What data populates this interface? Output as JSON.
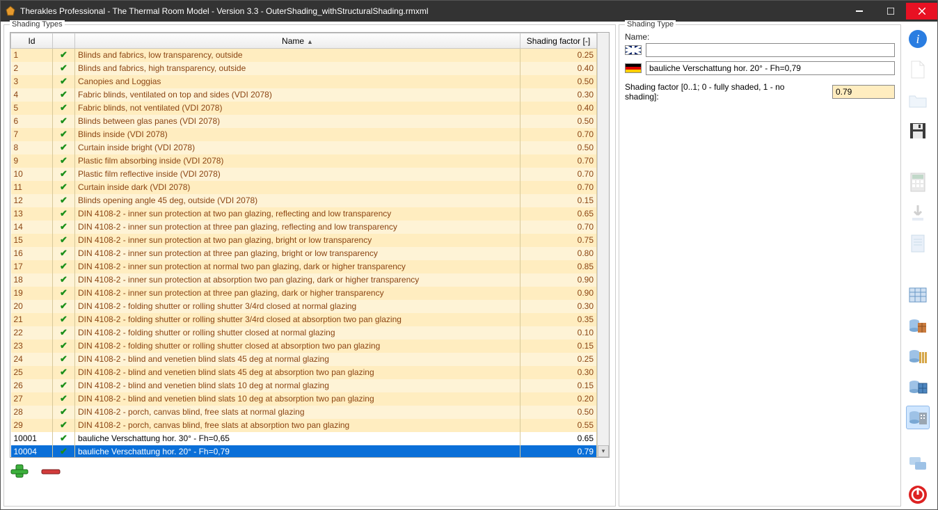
{
  "window": {
    "title": "Therakles Professional - The Thermal Room Model - Version 3.3 - OuterShading_withStructuralShading.rmxml"
  },
  "left": {
    "groupLabel": "Shading Types",
    "columns": {
      "id": "Id",
      "name": "Name",
      "factor": "Shading factor [-]"
    },
    "rows": [
      {
        "id": "1",
        "name": "Blinds and fabrics, low transparency, outside",
        "factor": "0.25",
        "builtin": true
      },
      {
        "id": "2",
        "name": "Blinds and fabrics, high transparency, outside",
        "factor": "0.40",
        "builtin": true
      },
      {
        "id": "3",
        "name": "Canopies and Loggias",
        "factor": "0.50",
        "builtin": true
      },
      {
        "id": "4",
        "name": "Fabric blinds, ventilated on top and sides (VDI 2078)",
        "factor": "0.30",
        "builtin": true
      },
      {
        "id": "5",
        "name": "Fabric blinds, not ventilated (VDI 2078)",
        "factor": "0.40",
        "builtin": true
      },
      {
        "id": "6",
        "name": "Blinds between glas panes (VDI 2078)",
        "factor": "0.50",
        "builtin": true
      },
      {
        "id": "7",
        "name": "Blinds inside (VDI 2078)",
        "factor": "0.70",
        "builtin": true
      },
      {
        "id": "8",
        "name": "Curtain inside bright (VDI 2078)",
        "factor": "0.50",
        "builtin": true
      },
      {
        "id": "9",
        "name": "Plastic film absorbing inside (VDI 2078)",
        "factor": "0.70",
        "builtin": true
      },
      {
        "id": "10",
        "name": "Plastic film reflective inside (VDI 2078)",
        "factor": "0.70",
        "builtin": true
      },
      {
        "id": "11",
        "name": "Curtain inside dark (VDI 2078)",
        "factor": "0.70",
        "builtin": true
      },
      {
        "id": "12",
        "name": "Blinds opening angle 45 deg, outside (VDI 2078)",
        "factor": "0.15",
        "builtin": true
      },
      {
        "id": "13",
        "name": "DIN 4108-2 - inner sun protection at two pan glazing, reflecting and low transparency",
        "factor": "0.65",
        "builtin": true
      },
      {
        "id": "14",
        "name": "DIN 4108-2 - inner sun protection at three pan glazing, reflecting and low transparency",
        "factor": "0.70",
        "builtin": true
      },
      {
        "id": "15",
        "name": "DIN 4108-2 - inner sun protection at two pan glazing, bright or low transparency",
        "factor": "0.75",
        "builtin": true
      },
      {
        "id": "16",
        "name": "DIN 4108-2 - inner sun protection at three pan glazing, bright or low transparency",
        "factor": "0.80",
        "builtin": true
      },
      {
        "id": "17",
        "name": "DIN 4108-2 - inner sun protection at normal two pan glazing, dark or higher transparency",
        "factor": "0.85",
        "builtin": true
      },
      {
        "id": "18",
        "name": "DIN 4108-2 - inner sun protection at absorption two pan glazing, dark or higher transparency",
        "factor": "0.90",
        "builtin": true
      },
      {
        "id": "19",
        "name": "DIN 4108-2 - inner sun protection at three pan glazing, dark or higher transparency",
        "factor": "0.90",
        "builtin": true
      },
      {
        "id": "20",
        "name": "DIN 4108-2 - folding shutter or rolling shutter 3/4rd closed at normal glazing",
        "factor": "0.30",
        "builtin": true
      },
      {
        "id": "21",
        "name": "DIN 4108-2 - folding shutter or rolling shutter 3/4rd closed at absorption two pan glazing",
        "factor": "0.35",
        "builtin": true
      },
      {
        "id": "22",
        "name": "DIN 4108-2 - folding shutter or rolling shutter closed at normal glazing",
        "factor": "0.10",
        "builtin": true
      },
      {
        "id": "23",
        "name": "DIN 4108-2 - folding shutter or rolling shutter closed at absorption two pan glazing",
        "factor": "0.15",
        "builtin": true
      },
      {
        "id": "24",
        "name": "DIN 4108-2 - blind and venetien blind slats 45 deg at normal glazing",
        "factor": "0.25",
        "builtin": true
      },
      {
        "id": "25",
        "name": "DIN 4108-2 - blind and venetien blind slats 45 deg at absorption two pan glazing",
        "factor": "0.30",
        "builtin": true
      },
      {
        "id": "26",
        "name": "DIN 4108-2 - blind and venetien blind slats 10 deg at normal glazing",
        "factor": "0.15",
        "builtin": true
      },
      {
        "id": "27",
        "name": "DIN 4108-2 - blind and venetien blind slats 10 deg at absorption two pan glazing",
        "factor": "0.20",
        "builtin": true
      },
      {
        "id": "28",
        "name": "DIN 4108-2 - porch, canvas blind, free slats at normal glazing",
        "factor": "0.50",
        "builtin": true
      },
      {
        "id": "29",
        "name": "DIN 4108-2 - porch, canvas blind, free slats at absorption two pan glazing",
        "factor": "0.55",
        "builtin": true
      },
      {
        "id": "10001",
        "name": "bauliche Verschattung hor. 30° - Fh=0,65",
        "factor": "0.65",
        "builtin": false
      },
      {
        "id": "10004",
        "name": "bauliche Verschattung hor. 20° - Fh=0,79",
        "factor": "0.79",
        "builtin": false,
        "selected": true
      }
    ]
  },
  "right": {
    "groupLabel": "Shading Type",
    "nameLabel": "Name:",
    "name_en": "",
    "name_de": "bauliche Verschattung hor. 20° - Fh=0,79",
    "factorLabel": "Shading factor [0..1; 0 - fully shaded, 1 - no shading]:",
    "factorValue": "0.79"
  },
  "toolbar": {
    "info": "info-icon",
    "new": "new-icon",
    "open": "open-icon",
    "save": "save-icon",
    "calc": "calculator-icon",
    "download": "download-icon",
    "report": "report-icon",
    "grid": "grid-icon",
    "db1": "database-icon",
    "db2": "database-columns-icon",
    "db3": "database-building-icon",
    "db4": "database-building2-icon",
    "chat": "chat-icon",
    "power": "power-icon"
  }
}
